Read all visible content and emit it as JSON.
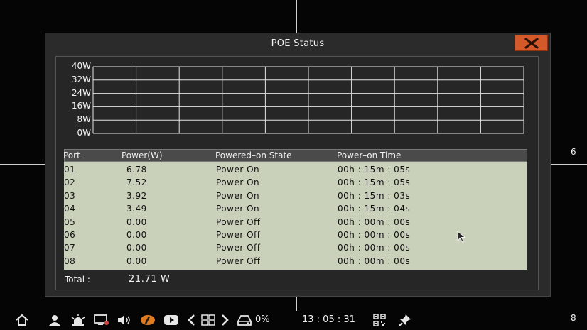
{
  "dialog": {
    "title": "POE Status",
    "close_icon": "close-icon"
  },
  "chart_data": {
    "type": "line",
    "y_ticks": [
      "40W",
      "32W",
      "24W",
      "16W",
      "8W",
      "0W"
    ],
    "ylim": [
      0,
      40
    ],
    "grid": true,
    "columns": 10,
    "series": []
  },
  "table": {
    "headers": [
      "Port",
      "Power(W)",
      "Powered–on State",
      "Power–on Time"
    ],
    "rows": [
      {
        "port": "01",
        "power": "6.78",
        "state": "Power  On",
        "time": "00h : 15m : 05s"
      },
      {
        "port": "02",
        "power": "7.52",
        "state": "Power  On",
        "time": "00h : 15m : 05s"
      },
      {
        "port": "03",
        "power": "3.92",
        "state": "Power  On",
        "time": "00h : 15m : 03s"
      },
      {
        "port": "04",
        "power": "3.49",
        "state": "Power  On",
        "time": "00h : 15m : 04s"
      },
      {
        "port": "05",
        "power": "0.00",
        "state": "Power  Off",
        "time": "00h : 00m : 00s"
      },
      {
        "port": "06",
        "power": "0.00",
        "state": "Power  Off",
        "time": "00h : 00m : 00s"
      },
      {
        "port": "07",
        "power": "0.00",
        "state": "Power  Off",
        "time": "00h : 00m : 00s"
      },
      {
        "port": "08",
        "power": "0.00",
        "state": "Power  Off",
        "time": "00h : 00m : 00s"
      }
    ]
  },
  "total": {
    "label": "Total :",
    "value": "21.71  W"
  },
  "channels": {
    "right_top": "6",
    "right_bottom": "8"
  },
  "taskbar": {
    "hdd_usage": "0%",
    "clock": "13 : 05 : 31",
    "icons": [
      "home-icon",
      "user-icon",
      "alarm-icon",
      "monitor-icon",
      "volume-icon",
      "record-icon",
      "playback-icon",
      "prev-icon",
      "grid-layout-icon",
      "next-icon",
      "hdd-icon",
      "qr-code-icon",
      "pin-icon"
    ],
    "colors": {
      "record": "#e07a1f",
      "close_button": "#d3582a"
    }
  }
}
